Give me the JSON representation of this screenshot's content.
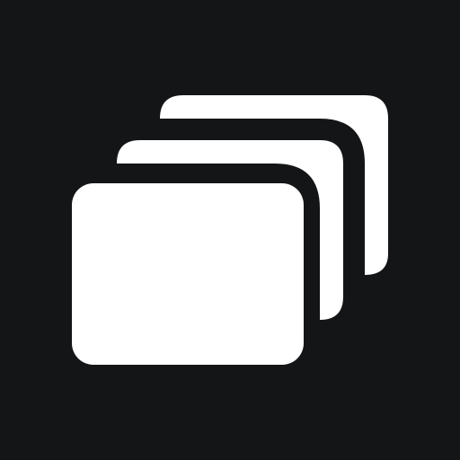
{
  "icon": {
    "name": "stacked-cards-icon",
    "colors": {
      "background": "#141517",
      "foreground": "#ffffff"
    }
  }
}
